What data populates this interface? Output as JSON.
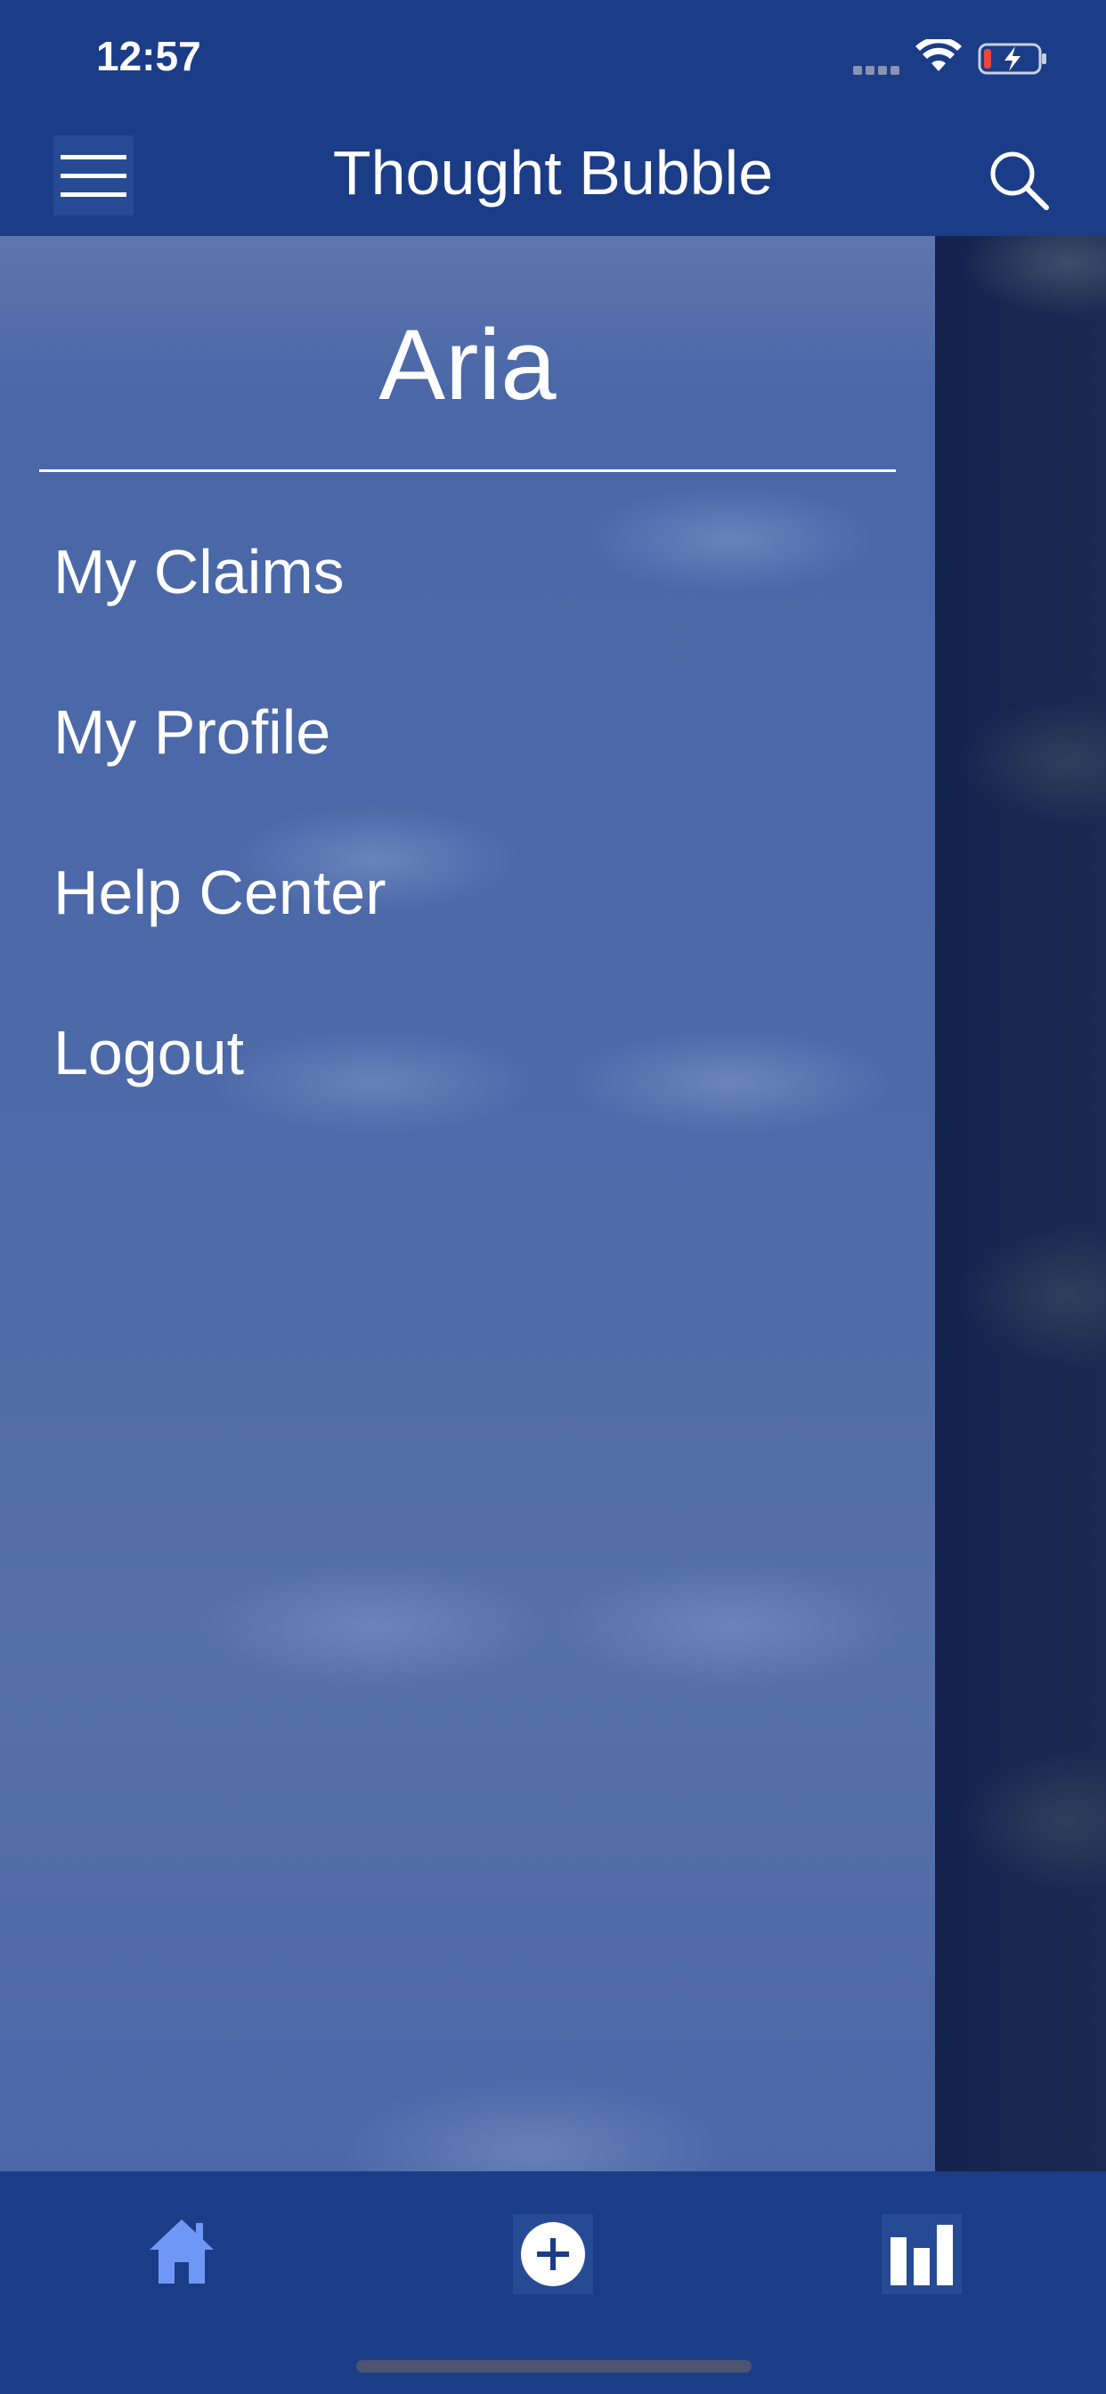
{
  "status_bar": {
    "time": "12:57",
    "icons": [
      "signal-icon",
      "wifi-icon",
      "battery-charging-icon"
    ],
    "battery_low_color": "#e8473f"
  },
  "nav": {
    "title": "Thought Bubble",
    "left_icon": "hamburger-menu-icon",
    "right_icon": "search-icon"
  },
  "drawer": {
    "username": "Aria",
    "items": [
      {
        "label": "My Claims"
      },
      {
        "label": "My Profile"
      },
      {
        "label": "Help Center"
      },
      {
        "label": "Logout"
      }
    ]
  },
  "tab_bar": {
    "tabs": [
      {
        "icon": "home-icon",
        "color": "#6f97f5"
      },
      {
        "icon": "add-circle-icon",
        "color": "#ffffff"
      },
      {
        "icon": "bar-chart-icon",
        "color": "#ffffff"
      }
    ]
  },
  "colors": {
    "primary": "#1b3c87",
    "drawer": "#4c69a8",
    "text": "#ffffff"
  }
}
